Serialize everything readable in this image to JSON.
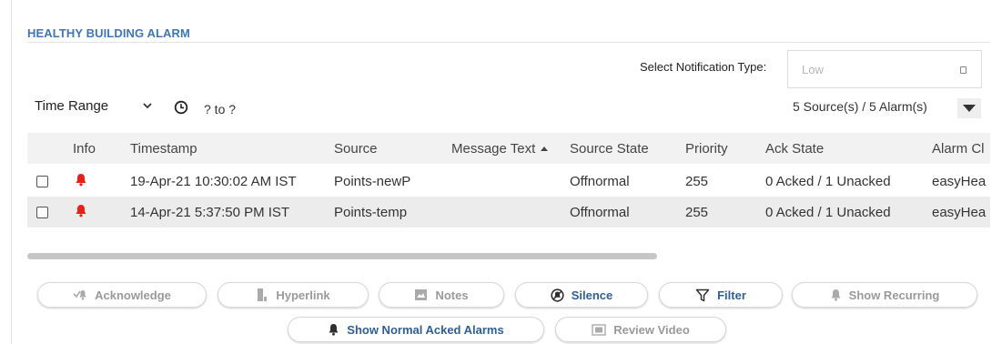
{
  "panel": {
    "title": "HEALTHY BUILDING ALARM"
  },
  "notification": {
    "label": "Select Notification Type:",
    "value": "Low"
  },
  "time_range": {
    "selected": "Time Range",
    "range_text": "? to ?"
  },
  "summary": {
    "counts": "5 Source(s) / 5 Alarm(s)"
  },
  "table": {
    "headers": {
      "info": "Info",
      "timestamp": "Timestamp",
      "source": "Source",
      "message": "Message Text",
      "state": "Source State",
      "priority": "Priority",
      "ack": "Ack State",
      "alarm_class": "Alarm Cl"
    },
    "rows": [
      {
        "timestamp": "19-Apr-21 10:30:02 AM IST",
        "source": "Points-newP",
        "message": "",
        "state": "Offnormal",
        "priority": "255",
        "ack": "0 Acked / 1 Unacked",
        "alarm_class": "easyHea"
      },
      {
        "timestamp": "14-Apr-21 5:37:50 PM IST",
        "source": "Points-temp",
        "message": "",
        "state": "Offnormal",
        "priority": "255",
        "ack": "0 Acked / 1 Unacked",
        "alarm_class": "easyHea"
      }
    ]
  },
  "buttons": {
    "acknowledge": "Acknowledge",
    "hyperlink": "Hyperlink",
    "notes": "Notes",
    "silence": "Silence",
    "filter": "Filter",
    "show_recurring": "Show Recurring",
    "show_normal_acked": "Show Normal Acked Alarms",
    "review_video": "Review Video"
  },
  "colors": {
    "title": "#3d77b7",
    "enabled_button": "#2f5f93",
    "disabled_button": "#9a9a9a",
    "alarm_bell": "#e8201c",
    "header_bg": "#f2f2f2"
  },
  "icons": {
    "alarm": "bell-icon",
    "time": "clock-icon",
    "dropdown": "chevron-down-icon",
    "acknowledge": "acknowledge-icon",
    "hyperlink": "hyperlink-icon",
    "notes": "notes-icon",
    "silence": "silence-icon",
    "filter": "filter-icon",
    "recurring": "bell-icon",
    "normal_acked": "bell-icon",
    "review_video": "video-icon"
  }
}
